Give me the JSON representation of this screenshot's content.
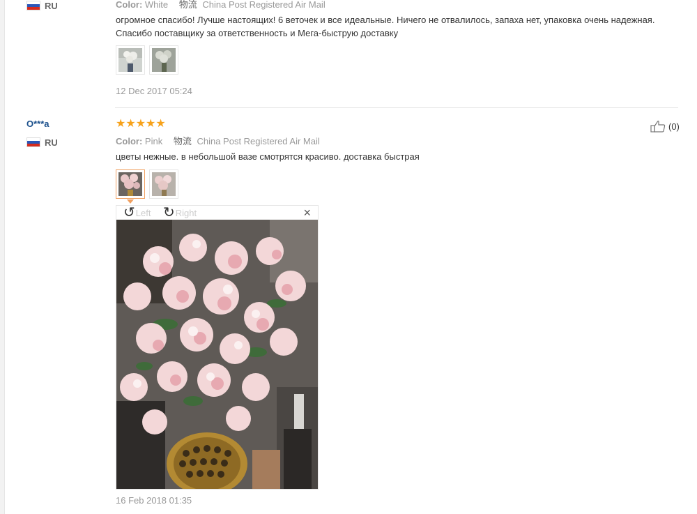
{
  "review_1": {
    "country": "RU",
    "color_label": "Color:",
    "color_value": "White",
    "shipping_label": "物流",
    "shipping_value": "China Post Registered Air Mail",
    "comment": "огромное спасибо! Лучше настоящих! 6 веточек и все идеальные. Ничего не отвалилось, запаха нет, упаковка очень надежная. Спасибо поставщику за ответственность и Мега-быструю доставку",
    "date": "12 Dec 2017 05:24"
  },
  "review_2": {
    "username": "O***a",
    "country": "RU",
    "stars": "★★★★★",
    "rating": 5,
    "color_label": "Color:",
    "color_value": "Pink",
    "shipping_label": "物流",
    "shipping_value": "China Post Registered Air Mail",
    "comment": "цветы нежные. в небольшой вазе смотрятся красиво. доставка быстрая",
    "likes": "(0)",
    "date": "16 Feb 2018 01:35"
  },
  "viewer": {
    "rotate_left": "Left",
    "rotate_right": "Right",
    "close": "×"
  },
  "icons": {
    "flag": "russia-flag-icon",
    "like": "thumbs-up-icon",
    "rotate_left": "rotate-left-icon",
    "rotate_right": "rotate-right-icon",
    "close": "close-icon"
  },
  "colors": {
    "username": "#1a4f8b",
    "star": "#f7a21b",
    "active_thumb": "#f0a060"
  }
}
